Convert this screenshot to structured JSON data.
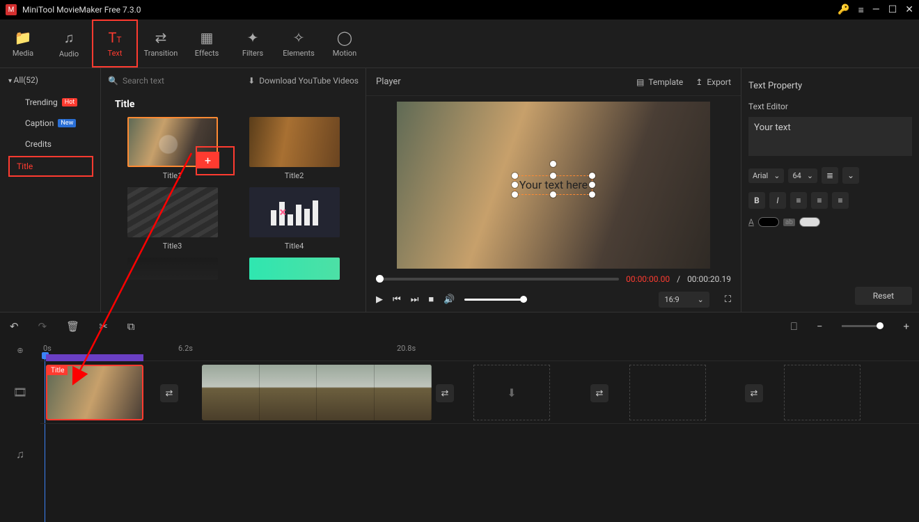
{
  "app": {
    "title": "MiniTool MovieMaker Free 7.3.0"
  },
  "toolbar": {
    "media": "Media",
    "audio": "Audio",
    "text": "Text",
    "transition": "Transition",
    "effects": "Effects",
    "filters": "Filters",
    "elements": "Elements",
    "motion": "Motion"
  },
  "sidebar": {
    "header": "All(52)",
    "trending": "Trending",
    "trending_badge": "Hot",
    "caption": "Caption",
    "caption_badge": "New",
    "credits": "Credits",
    "title": "Title"
  },
  "assets": {
    "search_placeholder": "Search text",
    "download_link": "Download YouTube Videos",
    "section_title": "Title",
    "cards": {
      "t1": "Title1",
      "t2": "Title2",
      "t3": "Title3",
      "t4": "Title4"
    },
    "add": "+"
  },
  "player": {
    "label": "Player",
    "template": "Template",
    "export": "Export",
    "overlay_text": "Your text here",
    "tc_current": "00:00:00.00",
    "tc_sep": "/",
    "tc_total": "00:00:20.19",
    "aspect": "16:9"
  },
  "props": {
    "panel_title": "Text Property",
    "editor_label": "Text Editor",
    "text_value": "Your text",
    "font": "Arial",
    "size": "64",
    "reset": "Reset"
  },
  "timeline": {
    "ruler": {
      "t0": "0s",
      "t1": "6.2s",
      "t2": "20.8s"
    },
    "title_tag": "Title"
  }
}
